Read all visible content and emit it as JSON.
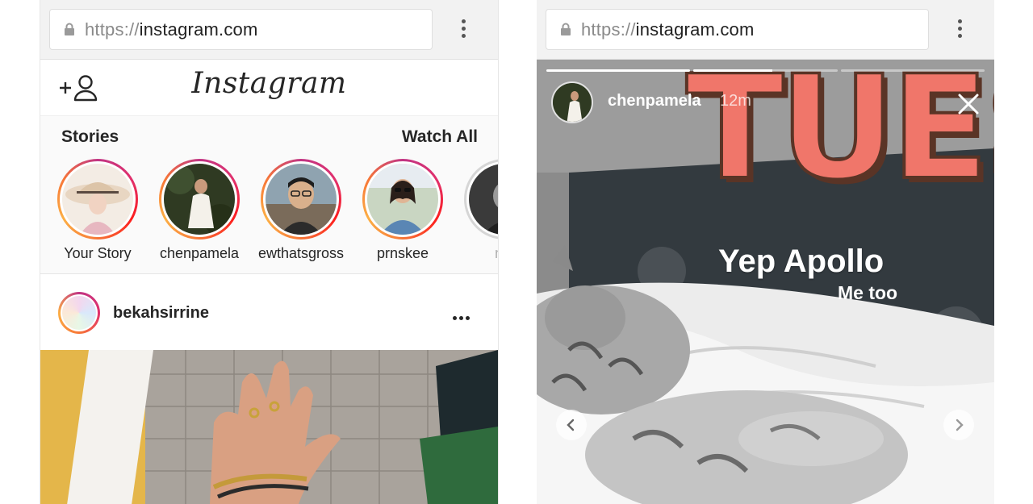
{
  "browser": {
    "url_scheme": "https://",
    "url_host": "instagram.com"
  },
  "feed": {
    "app_title": "Instagram",
    "stories": {
      "title": "Stories",
      "watch_all": "Watch All",
      "items": [
        {
          "label": "Your Story"
        },
        {
          "label": "chenpamela"
        },
        {
          "label": "ewthatsgross"
        },
        {
          "label": "prnskee"
        },
        {
          "label": "mc"
        }
      ]
    },
    "post": {
      "username": "bekahsirrine"
    }
  },
  "story_viewer": {
    "username": "chenpamela",
    "time": "12m",
    "overlay_big": "TUES",
    "caption_main": "Yep Apollo",
    "caption_sub": "Me too",
    "progress": [
      1.0,
      0.55,
      0.0
    ]
  },
  "colors": {
    "story_ring_start": "#c13584",
    "story_ring_end": "#fcaf45",
    "tues_fill": "#f0766a",
    "tues_outline": "#5a3426"
  }
}
